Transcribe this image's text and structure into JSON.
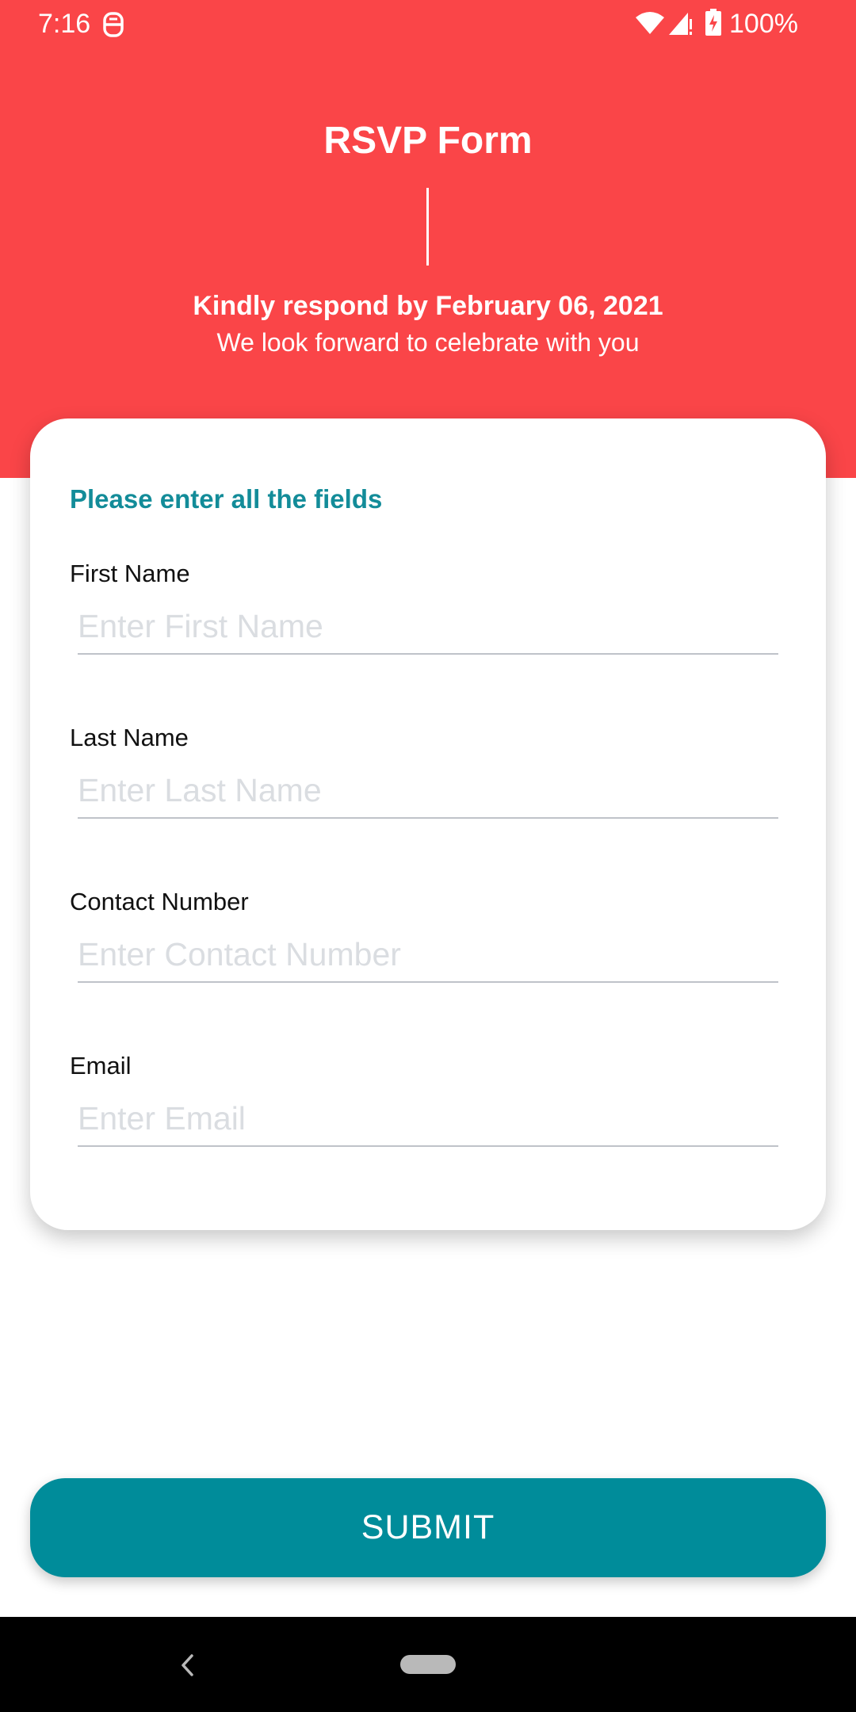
{
  "status_bar": {
    "time": "7:16",
    "battery_text": "100%",
    "icons": [
      "notification-icon",
      "wifi-icon",
      "signal-icon",
      "battery-charging-icon"
    ]
  },
  "header": {
    "title": "RSVP Form",
    "respond_by": "Kindly respond by February 06, 2021",
    "tagline": "We look forward to celebrate with you"
  },
  "form": {
    "heading": "Please enter all the fields",
    "fields": [
      {
        "label": "First Name",
        "placeholder": "Enter First Name",
        "value": ""
      },
      {
        "label": "Last Name",
        "placeholder": "Enter Last Name",
        "value": ""
      },
      {
        "label": "Contact Number",
        "placeholder": "Enter Contact Number",
        "value": ""
      },
      {
        "label": "Email",
        "placeholder": "Enter Email",
        "value": ""
      }
    ]
  },
  "submit": {
    "label": "SUBMIT"
  },
  "nav_bar": {
    "icons": [
      "back-icon",
      "home-pill"
    ]
  },
  "colors": {
    "header_red": "#fa4548",
    "accent_teal": "#008c9a",
    "heading_teal": "#138c99"
  }
}
